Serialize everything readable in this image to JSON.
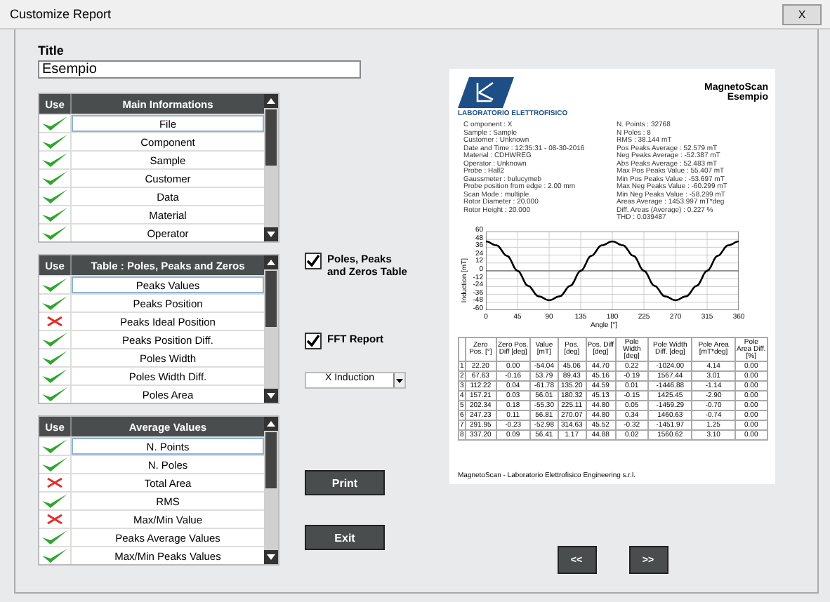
{
  "window": {
    "title": "Customize Report",
    "close": "X"
  },
  "title_field": {
    "label": "Title",
    "value": "Esempio"
  },
  "tables": [
    {
      "use_header": "Use",
      "title": "Main Informations",
      "rows": [
        {
          "label": "File",
          "use": true,
          "selected": true
        },
        {
          "label": "Component",
          "use": true,
          "selected": false
        },
        {
          "label": "Sample",
          "use": true,
          "selected": false
        },
        {
          "label": "Customer",
          "use": true,
          "selected": false
        },
        {
          "label": "Data",
          "use": true,
          "selected": false
        },
        {
          "label": "Material",
          "use": true,
          "selected": false
        },
        {
          "label": "Operator",
          "use": true,
          "selected": false
        }
      ]
    },
    {
      "use_header": "Use",
      "title": "Table : Poles, Peaks and Zeros",
      "rows": [
        {
          "label": "Peaks  Values",
          "use": true,
          "selected": true
        },
        {
          "label": "Peaks Position",
          "use": true,
          "selected": false
        },
        {
          "label": "Peaks Ideal Position",
          "use": false,
          "selected": false
        },
        {
          "label": "Peaks Position Diff.",
          "use": true,
          "selected": false
        },
        {
          "label": "Poles Width",
          "use": true,
          "selected": false
        },
        {
          "label": "Poles Width Diff.",
          "use": true,
          "selected": false
        },
        {
          "label": "Poles Area",
          "use": true,
          "selected": false
        }
      ]
    },
    {
      "use_header": "Use",
      "title": "Average Values",
      "rows": [
        {
          "label": "N. Points",
          "use": true,
          "selected": true
        },
        {
          "label": "N. Poles",
          "use": true,
          "selected": false
        },
        {
          "label": "Total Area",
          "use": false,
          "selected": false
        },
        {
          "label": "RMS",
          "use": true,
          "selected": false
        },
        {
          "label": "Max/Min Value",
          "use": false,
          "selected": false
        },
        {
          "label": "Peaks Average Values",
          "use": true,
          "selected": false
        },
        {
          "label": "Max/Min Peaks Values",
          "use": true,
          "selected": false
        }
      ]
    }
  ],
  "options": [
    {
      "label": "Poles, Peaks and Zeros Table",
      "checked": true
    },
    {
      "label": "FFT Report",
      "checked": true
    }
  ],
  "dropdown": {
    "value": "X Induction"
  },
  "buttons": [
    "Print",
    "Exit"
  ],
  "report": {
    "app": "MagnetoScan",
    "title": "Esempio",
    "logo_text": "LABORATORIO ELETTROFISICO",
    "info_left": [
      "C omponent : X",
      "Sample : Sample",
      "Customer : Unknown",
      "Date and Time : 12:35:31 - 08-30-2016",
      "Material : CDHWREG",
      "Operator : Unknown",
      "Probe : Hall2",
      "Gaussmeter : bulucymeb",
      "Probe position from edge : 2.00 mm",
      "Scan Mode : multiple",
      "Rotor Diameter : 20.000",
      "Rotor Height : 20.000"
    ],
    "info_right": [
      "N. Points : 32768",
      "N Poles : 8",
      "RMS : 38.144 mT",
      "Pos Peaks Average : 52.579 mT",
      "Neg Peaks Average : -52.387 mT",
      "Abs Peaks Average : 52.483 mT",
      "Max Pos Peaks Value : 55.407 mT",
      "Min Pos Peaks Value : -53.697 mT",
      "Max Neg Peaks Value : -60.299 mT",
      "Min Neg Peaks Value : -58.299 mT",
      "Areas Average : 1453.997 mT*deg",
      "Diff. Areas (Average) : 0.227 %",
      "THD : 0.039487"
    ],
    "chart_data": {
      "type": "line",
      "xlabel": "Angle [°]",
      "ylabel": "Induction [mT]",
      "x": [
        0,
        15,
        30,
        45,
        60,
        75,
        90,
        105,
        120,
        135,
        150,
        165,
        180,
        195,
        210,
        225,
        240,
        255,
        270,
        285,
        300,
        315,
        330,
        345,
        360
      ],
      "grid": true,
      "series": [
        {
          "color": "#000000",
          "values": [
            45,
            39,
            23,
            0,
            -23,
            -39,
            -45,
            -39,
            -23,
            0,
            23,
            39,
            45,
            39,
            23,
            0,
            -23,
            -39,
            -45,
            -39,
            -23,
            0,
            23,
            39,
            45
          ]
        }
      ],
      "xlim": [
        0,
        360
      ],
      "ylim": [
        -60,
        60
      ],
      "xticks": [
        0,
        45,
        90,
        135,
        180,
        225,
        270,
        315,
        360
      ],
      "yticks": [
        -60,
        -48,
        -36,
        -24,
        -12,
        0,
        12,
        24,
        36,
        48,
        60
      ]
    },
    "table": {
      "columns": [
        "",
        "Zero Pos. [°]",
        "Zero Pos. Diff [deg]",
        "Value [mT]",
        "Pos. [deg]",
        "Pos. Diff [deg]",
        "Pole Width [deg]",
        "Pole Width Diff. [deg]",
        "Pole Area [mT*deg]",
        "Pole Area Diff. [%]"
      ],
      "rows": [
        [
          "1",
          "22.20",
          "0.00",
          "-54.04",
          "45.06",
          "44.70",
          "0.22",
          "-1024.00",
          "4.14",
          "0.00"
        ],
        [
          "2",
          "67.63",
          "-0.16",
          "53.79",
          "89.43",
          "45.16",
          "-0.19",
          "1567.44",
          "3.01",
          "0.00"
        ],
        [
          "3",
          "112.22",
          "0.04",
          "-61.78",
          "135.20",
          "44.59",
          "0.01",
          "-1446.88",
          "-1.14",
          "0.00"
        ],
        [
          "4",
          "157.21",
          "0.03",
          "56.01",
          "180.32",
          "45.13",
          "-0.15",
          "1425.45",
          "-2.90",
          "0.00"
        ],
        [
          "5",
          "202.34",
          "0.18",
          "-55.30",
          "225.11",
          "44.80",
          "0.05",
          "-1459.29",
          "-0.70",
          "0.00"
        ],
        [
          "6",
          "247.23",
          "0.11",
          "56.81",
          "270.07",
          "44.80",
          "0.34",
          "1460.63",
          "-0.74",
          "0.00"
        ],
        [
          "7",
          "291.95",
          "-0.23",
          "-52.98",
          "314.63",
          "45.52",
          "-0.32",
          "-1451.97",
          "1.25",
          "0.00"
        ],
        [
          "8",
          "337.20",
          "0.09",
          "56.41",
          "1.17",
          "44.88",
          "0.02",
          "1560.62",
          "3.10",
          "0.00"
        ]
      ]
    },
    "footer": "MagnetoScan - Laboratorio Elettrofisico Engineering s.r.l."
  },
  "nav_buttons": [
    "<<",
    ">>"
  ]
}
